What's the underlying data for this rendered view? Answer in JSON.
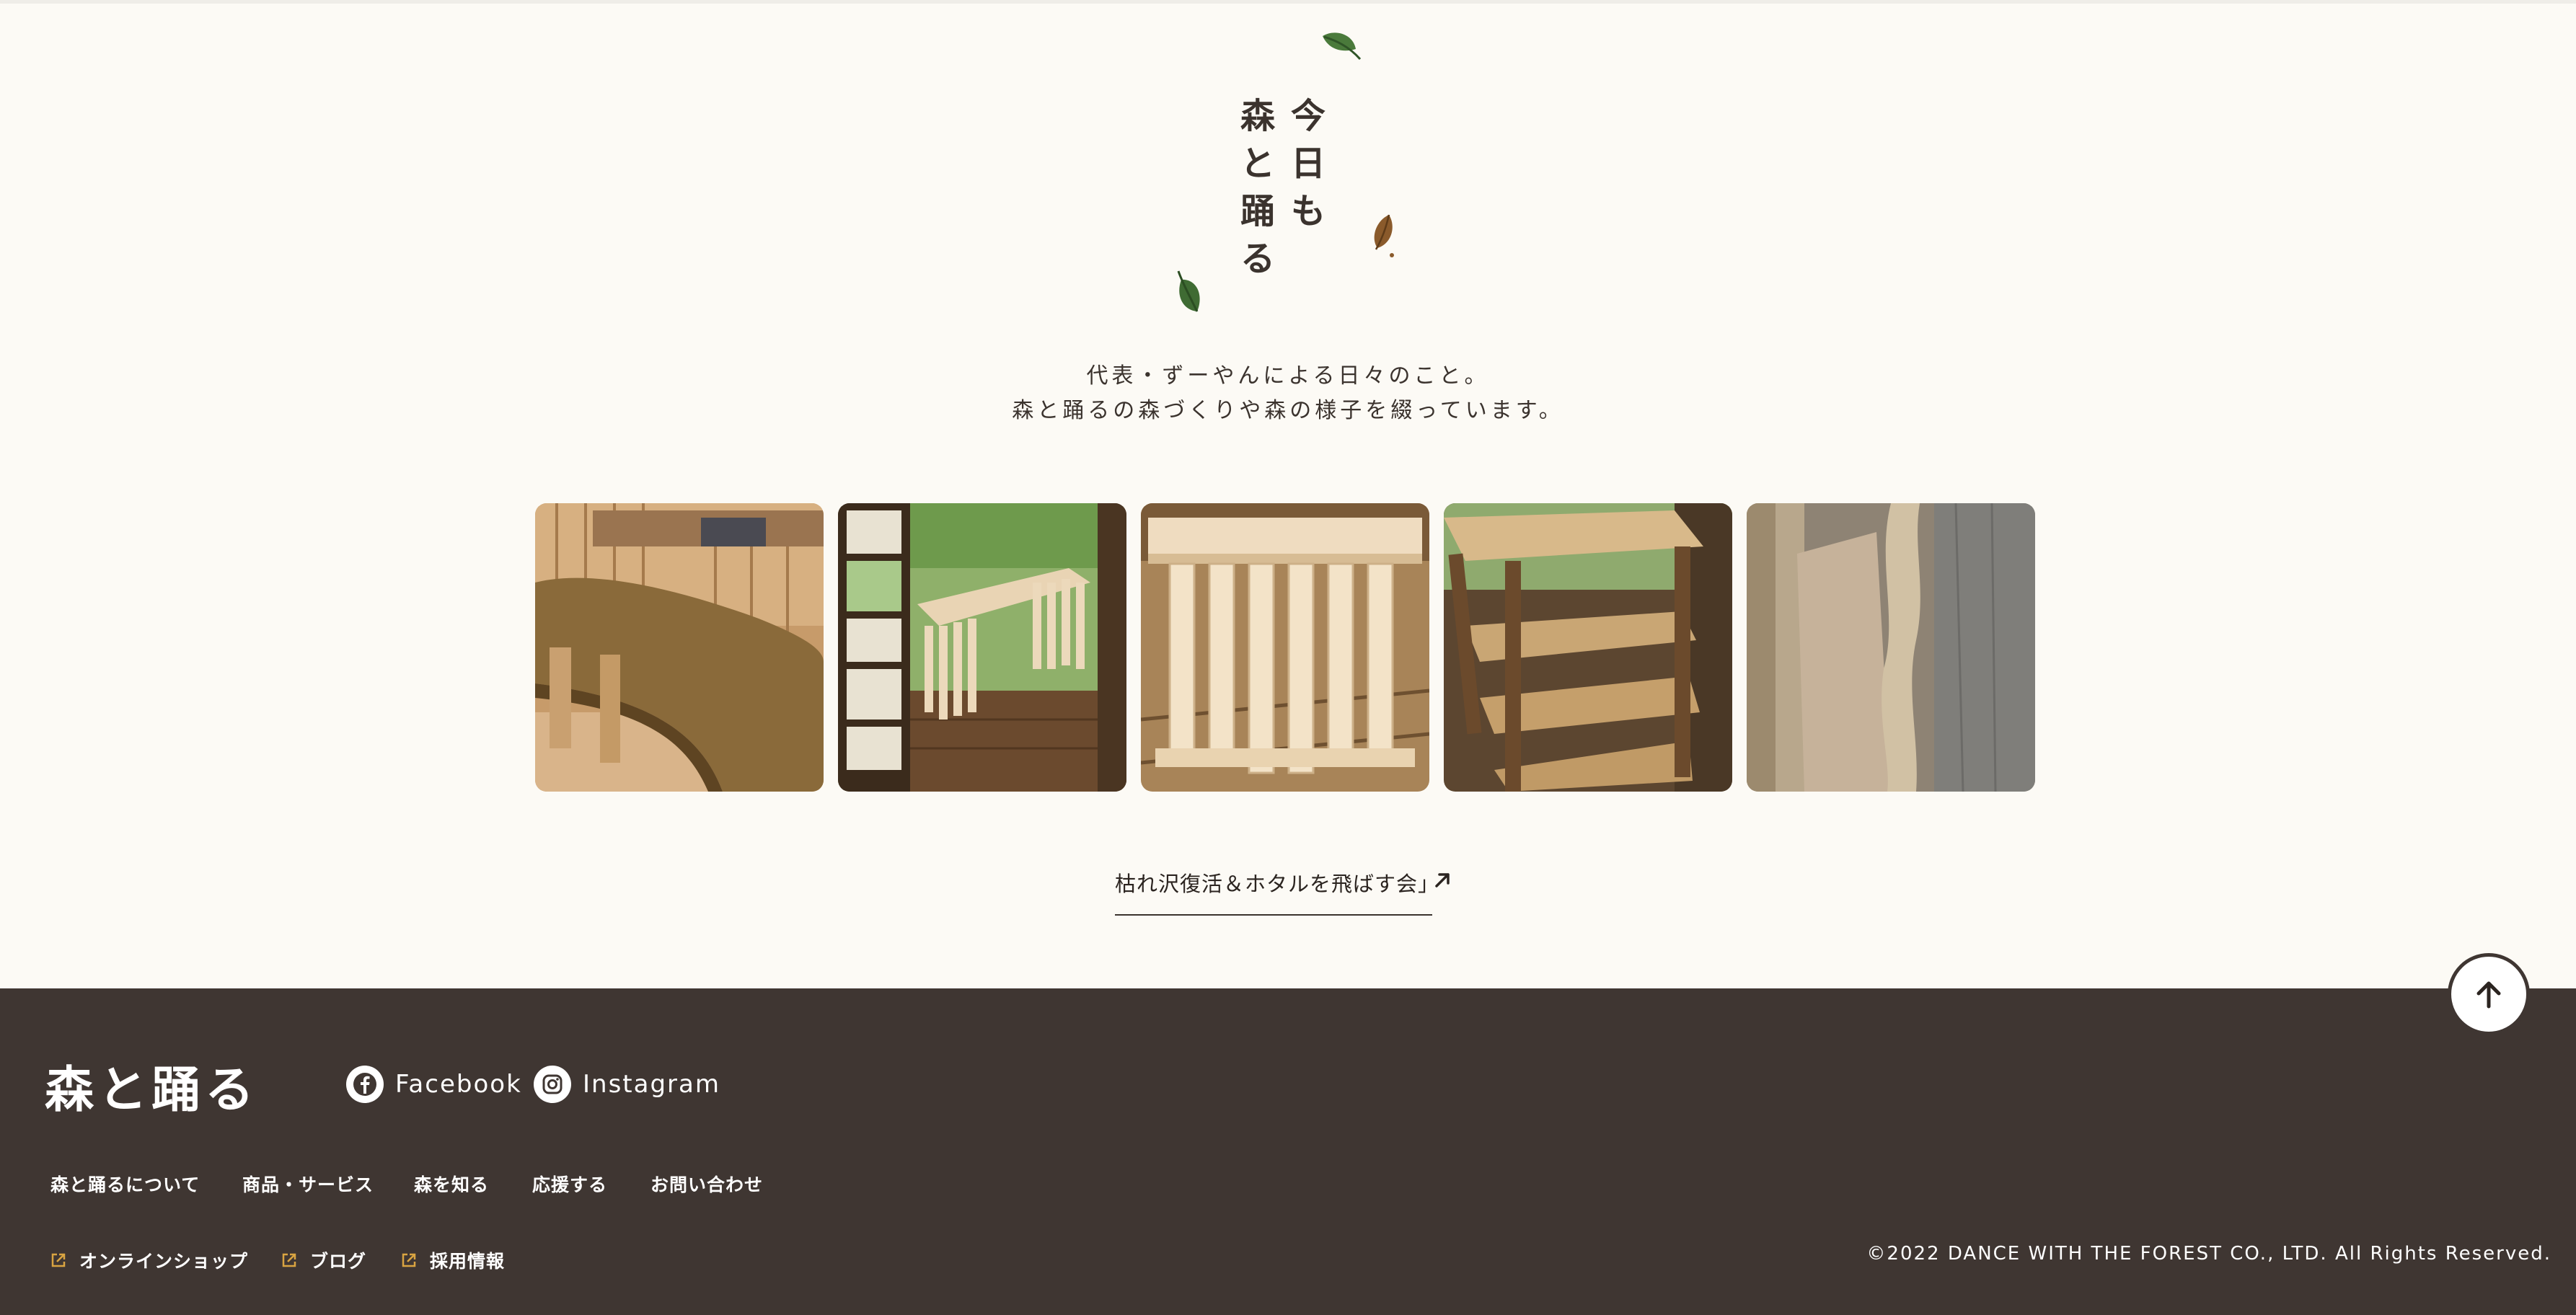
{
  "hero": {
    "title_col_right": [
      "今",
      "日",
      "も"
    ],
    "title_col_left": [
      "森",
      "と",
      "踊",
      "る"
    ],
    "desc_line1": "代表・ずーやんによる日々のこと。",
    "desc_line2": "森と踊るの森づくりや森の様子を綴っています。"
  },
  "gallery": {
    "photos": [
      "bench-photo",
      "veranda-table-photo",
      "slatted-stool-photo",
      "wooden-cart-photo",
      "timber-boards-photo"
    ]
  },
  "post": {
    "link_label": "枯れ沢復活＆ホタルを飛ばす会」"
  },
  "footer": {
    "logo": "森と踊る",
    "social": [
      {
        "label": "Facebook",
        "icon": "facebook-icon"
      },
      {
        "label": "Instagram",
        "icon": "instagram-icon"
      }
    ],
    "nav": [
      "森と踊るについて",
      "商品・サービス",
      "森を知る",
      "応援する",
      "お問い合わせ"
    ],
    "external": [
      "オンラインショップ",
      "ブログ",
      "採用情報"
    ],
    "copyright": "©2022 DANCE WITH THE FOREST CO., LTD. All Rights Reserved."
  },
  "colors": {
    "background": "#fcfaf5",
    "footer": "#3f3632",
    "text": "#3b332e",
    "accent_icon": "#d9a441",
    "leaf_green": "#3f6b33",
    "leaf_brown": "#8a5a2b"
  }
}
